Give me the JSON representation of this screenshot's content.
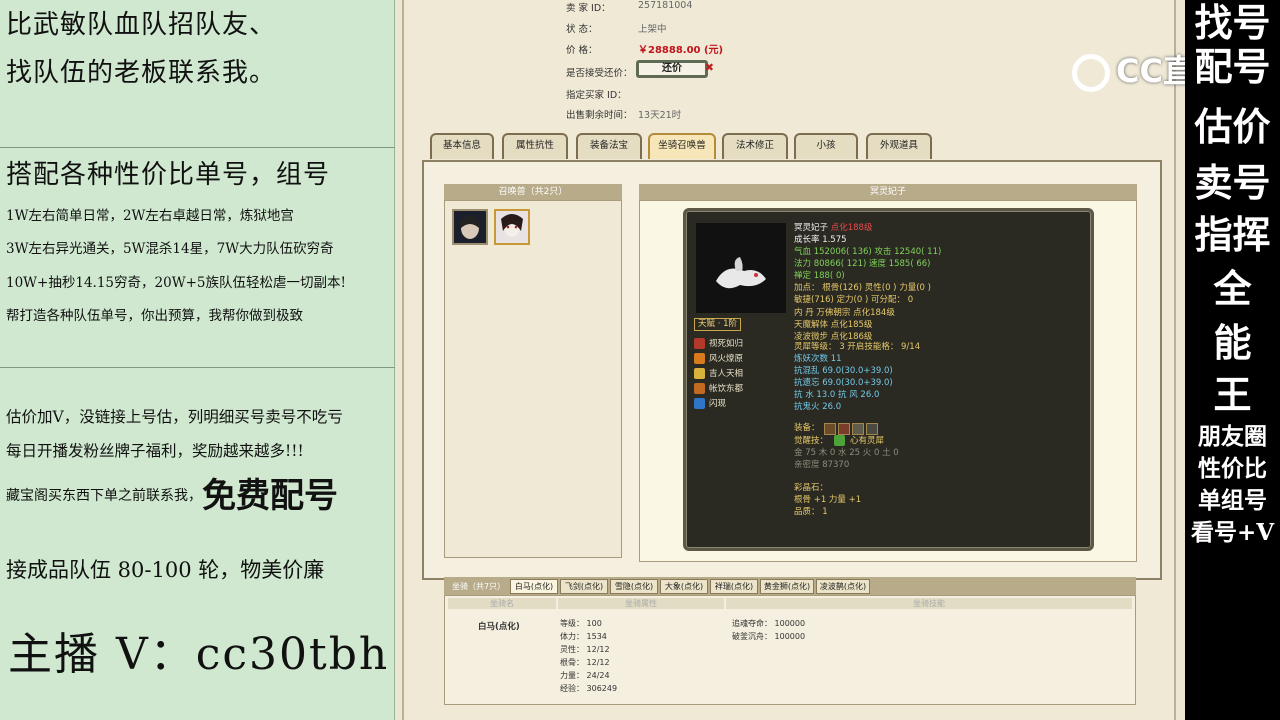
{
  "left": {
    "line1": "比武敏队血队招队友、",
    "line2": "找队伍的老板联系我。",
    "line3": "搭配各种性价比单号，组号",
    "line4": "1W左右简单日常，2W左右卓越日常，炼狱地宫",
    "line5": "3W左右异光通关，5W混杀14星，7W大力队伍砍穷奇",
    "line6": "10W+抽秒14.15穷奇，20W+5族队伍轻松虐一切副本!",
    "line7": "帮打造各种队伍单号，你出预算，我帮你做到极致",
    "line8": "估价加V，没链接上号估，列明细买号卖号不吃亏",
    "line9": "每日开播发粉丝牌子福利，奖励越来越多!!!",
    "line10a": "藏宝阁买东西下单之前联系我，",
    "line10b": "免费配号",
    "line11": "接成品队伍 80-100 轮，物美价廉",
    "host": "主播 V：cc30tbh"
  },
  "right": {
    "vertical": [
      "找号",
      "配号",
      "估价",
      "卖号",
      "指挥",
      "全",
      "能",
      "王"
    ],
    "bottom": [
      "朋友圈",
      "性价比",
      "单组号",
      "看号+V"
    ]
  },
  "logo": {
    "text": "CC直播"
  },
  "info": {
    "seller_label": "卖   家   ID：",
    "seller_value": "257181004",
    "status_label": "状          态：",
    "status_value": "上架中",
    "price_label": "价          格：",
    "price_value": "￥28888.00 (元)",
    "bargain_label": "是否接受还价：",
    "bargain_button": "还价",
    "buyer_label": "指定买家 ID：",
    "remain_label": "出售剩余时间：",
    "remain_value": "13天21时"
  },
  "tabs": [
    "基本信息",
    "属性抗性",
    "装备法宝",
    "坐骑召唤兽",
    "法术修正",
    "小孩",
    "外观道具"
  ],
  "pets": {
    "header": "召唤兽（共2只）"
  },
  "detail": {
    "header": "冥灵妃子",
    "name": "冥灵妃子",
    "name_extra": "点化188级",
    "growth": "成长率 1.575",
    "hp": "气血 152006( 136) 攻击 12540( 11)",
    "mp": "法力 80866( 121) 速度 1585( 66)",
    "zen": "禅定 188( 0)",
    "points1": "加点：  根骨(126) 灵性(0 ) 力量(0 )",
    "points2": "          敏捷(716) 定力(0 ) 可分配：  0",
    "neidan1": "内   丹  万佛朝宗 点化184级",
    "neidan2": "          天魔解体 点化185级",
    "neidan3": "          凌波微步 点化186级",
    "innate": "天赋 · 1阶",
    "skills": [
      "视死如归",
      "风火燎原",
      "吉人天相",
      "帐饮东都",
      "闪现"
    ],
    "spirit": "灵犀等级：  3 开启技能格：  9/14",
    "demon": "炼妖次数 11",
    "res1": "抗混乱  69.0(30.0+39.0)",
    "res2": "抗遗忘  69.0(30.0+39.0)",
    "res3": "抗   水  13.0 抗   风  26.0",
    "res4": "抗鬼火  26.0",
    "equip": "装备：",
    "awaken_label": "觉醒技：",
    "awaken_value": "心有灵犀",
    "elements": "金 75  木 0 水 25  火 0  土 0",
    "intimacy": "亲密度 87370",
    "gem_label": "彩晶石：",
    "gem1": "根骨 +1 力量 +1",
    "gem2": "品质：  1"
  },
  "mounts": {
    "header": "坐骑（共7只）",
    "tabs": [
      "白马(点化)",
      "飞剑(点化)",
      "雪隐(点化)",
      "大象(点化)",
      "祥瑞(点化)",
      "黄金狮(点化)",
      "凌波鹊(点化)"
    ],
    "col1": "坐骑名",
    "col2": "坐骑属性",
    "col3": "坐骑技能",
    "name": "白马(点化)",
    "stats": [
      "等级：  100",
      "体力：  1534",
      "灵性：  12/12",
      "根骨：  12/12",
      "力量：  24/24",
      "经验：  306249"
    ],
    "skill1": "追魂夺命：  100000",
    "skill2": "破釜沉舟：  100000"
  }
}
